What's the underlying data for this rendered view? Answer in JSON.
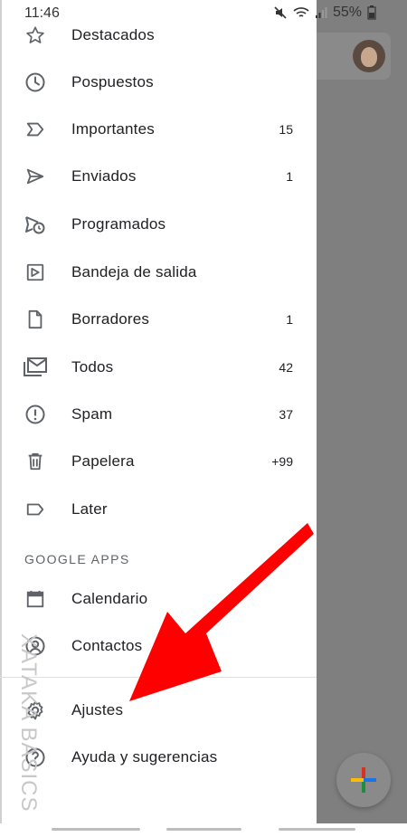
{
  "status_bar": {
    "time": "11:46",
    "battery": "55%"
  },
  "drawer": {
    "items": [
      {
        "icon": "star-icon",
        "label": "Destacados",
        "count": ""
      },
      {
        "icon": "clock-icon",
        "label": "Pospuestos",
        "count": ""
      },
      {
        "icon": "important-icon",
        "label": "Importantes",
        "count": "15"
      },
      {
        "icon": "send-icon",
        "label": "Enviados",
        "count": "1"
      },
      {
        "icon": "scheduled-send-icon",
        "label": "Programados",
        "count": ""
      },
      {
        "icon": "outbox-icon",
        "label": "Bandeja de salida",
        "count": ""
      },
      {
        "icon": "draft-icon",
        "label": "Borradores",
        "count": "1"
      },
      {
        "icon": "all-mail-icon",
        "label": "Todos",
        "count": "42"
      },
      {
        "icon": "spam-icon",
        "label": "Spam",
        "count": "37"
      },
      {
        "icon": "trash-icon",
        "label": "Papelera",
        "count": "+99"
      },
      {
        "icon": "label-icon",
        "label": "Later",
        "count": ""
      }
    ],
    "section_title": "GOOGLE APPS",
    "apps": [
      {
        "icon": "calendar-icon",
        "label": "Calendario"
      },
      {
        "icon": "contacts-icon",
        "label": "Contactos"
      }
    ],
    "footer": [
      {
        "icon": "gear-icon",
        "label": "Ajustes"
      },
      {
        "icon": "help-icon",
        "label": "Ayuda y sugerencias"
      }
    ]
  },
  "watermark": "XATAKA BASICS",
  "colors": {
    "annotation_arrow": "#ff0000",
    "scrim": "#7f7f7f",
    "text": "#202124",
    "icon": "#5f6368"
  }
}
